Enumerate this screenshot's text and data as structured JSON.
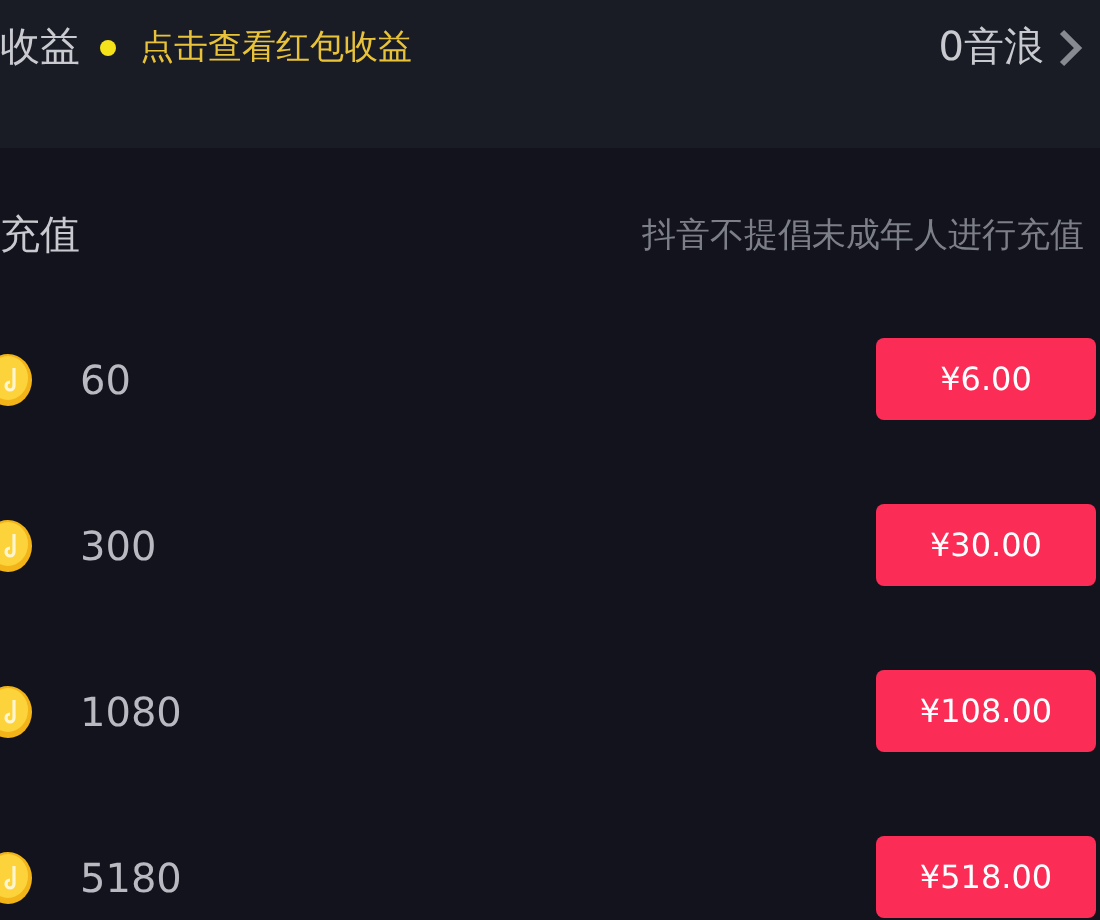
{
  "income": {
    "label": "收益",
    "hint": "点击查看红包收益",
    "balance": "0音浪"
  },
  "recharge": {
    "title": "充值",
    "notice": "抖音不提倡未成年人进行充值"
  },
  "packages": [
    {
      "amount": "60",
      "price": "¥6.00"
    },
    {
      "amount": "300",
      "price": "¥30.00"
    },
    {
      "amount": "1080",
      "price": "¥108.00"
    },
    {
      "amount": "5180",
      "price": "¥518.00"
    }
  ]
}
